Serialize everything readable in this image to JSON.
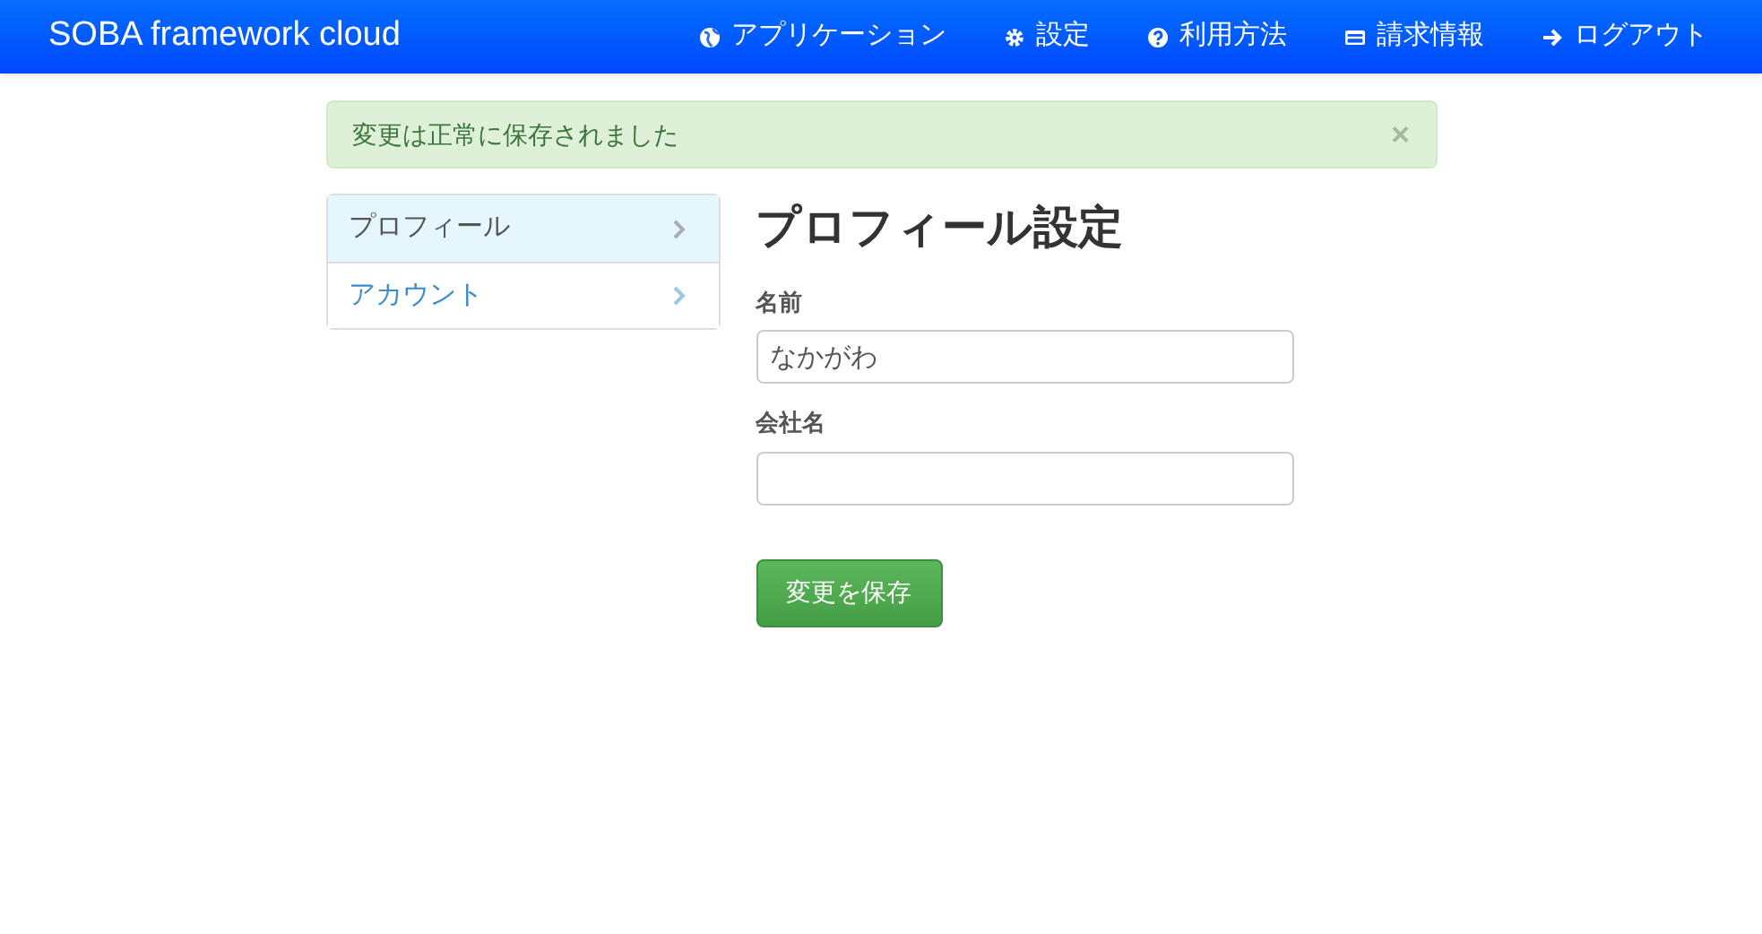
{
  "navbar": {
    "brand": "SOBA framework cloud",
    "items": [
      {
        "kind": "globe",
        "label": "アプリケーション"
      },
      {
        "kind": "gear",
        "label": "設定"
      },
      {
        "kind": "question",
        "label": "利用方法"
      },
      {
        "kind": "card",
        "label": "請求情報"
      },
      {
        "kind": "arrow",
        "label": "ログアウト"
      }
    ]
  },
  "alert": {
    "message": "変更は正常に保存されました",
    "close": "×"
  },
  "sidebar": {
    "items": [
      {
        "label": "プロフィール",
        "selected": true
      },
      {
        "label": "アカウント",
        "selected": false
      }
    ]
  },
  "form": {
    "title": "プロフィール設定",
    "fields": [
      {
        "label": "名前",
        "value": "なかがわ"
      },
      {
        "label": "会社名"
      }
    ],
    "submit": "変更を保存"
  }
}
